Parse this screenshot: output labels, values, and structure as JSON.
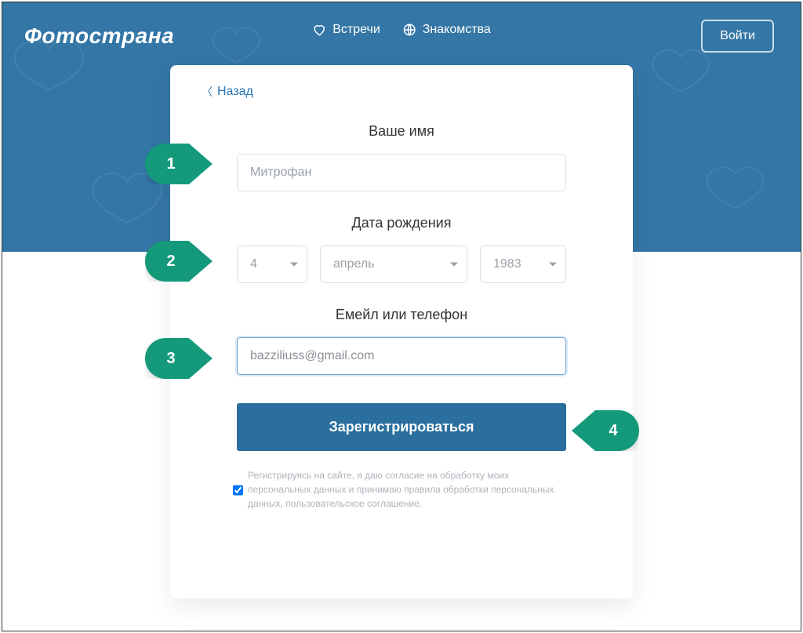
{
  "brand": "Фотострана",
  "nav": {
    "meetings": "Встречи",
    "dating": "Знакомства",
    "login": "Войти"
  },
  "card": {
    "back": "Назад",
    "name_label": "Ваше имя",
    "name_value": "Митрофан",
    "dob_label": "Дата рождения",
    "dob": {
      "day": "4",
      "month": "апрель",
      "year": "1983"
    },
    "email_label": "Емейл или телефон",
    "email_value": "bazziliuss@gmail.com",
    "submit": "Зарегистрироваться",
    "consent": "Регистрируясь на сайте, я даю согласие на обработку моих персональных данных и принимаю правила обработки персональных данных, пользовательское соглашение."
  },
  "callouts": {
    "s1": "1",
    "s2": "2",
    "s3": "3",
    "s4": "4"
  },
  "colors": {
    "accent": "#2b6f9e",
    "callout": "#149a7b",
    "banner": "#3476a6"
  }
}
